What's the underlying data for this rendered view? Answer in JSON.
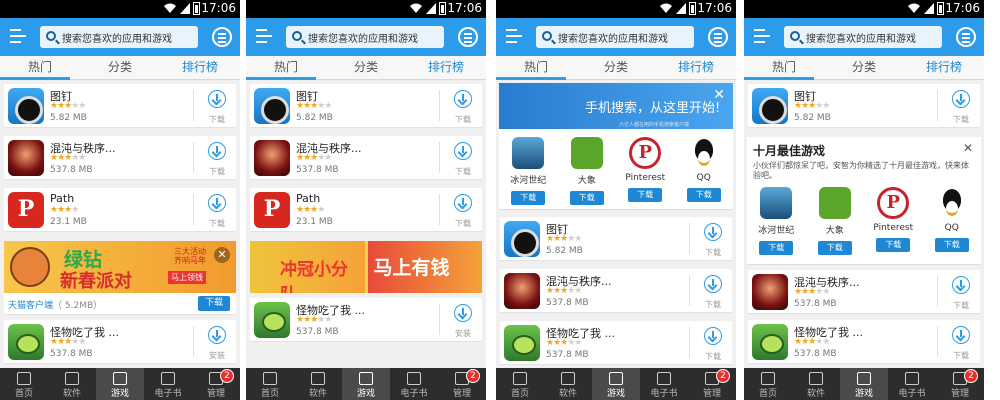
{
  "status": {
    "time": "17:06"
  },
  "topbar": {
    "search_placeholder": "搜索您喜欢的应用和游戏"
  },
  "tabs": [
    "热门",
    "分类",
    "排行榜"
  ],
  "apps": [
    {
      "name": "图钉",
      "size": "5.82 MB",
      "rating": 3
    },
    {
      "name": "混沌与秩序...",
      "size": "537.8 MB",
      "rating": 3
    },
    {
      "name": "Path",
      "size": "23.1 MB",
      "rating": 3
    },
    {
      "name": "怪物吃了我 ...",
      "size": "537.8 MB",
      "rating": 3
    }
  ],
  "download_label": "下载",
  "install_label": "安装",
  "banner1": {
    "title_line1": "绿钻",
    "title_line2": "新春派对",
    "promo_small": "三大活动\n齐响马年",
    "promo_btn": "马上领钱",
    "source_app": "天猫客户端",
    "source_size": "（ 5.2MB）",
    "download_btn": "下载"
  },
  "banner2": {
    "left_text": "冲冠小分队",
    "right_text": "马上有钱"
  },
  "promo": {
    "title": "手机搜索，从这里开始!",
    "subtitle": "六亿人都在用的手机搜索客户端",
    "apps": [
      {
        "label": "冰河世纪",
        "btn": "下载"
      },
      {
        "label": "大象",
        "btn": "下载"
      },
      {
        "label": "Pinterest",
        "btn": "下载"
      },
      {
        "label": "QQ",
        "btn": "下载"
      }
    ]
  },
  "popup": {
    "title": "十月最佳游戏",
    "desc": "小伙伴们都惊呆了吧，安智为你精选了十月最佳游戏，快来体验吧。",
    "apps": [
      {
        "label": "冰河世纪",
        "btn": "下载"
      },
      {
        "label": "大象",
        "btn": "下载"
      },
      {
        "label": "Pinterest",
        "btn": "下载"
      },
      {
        "label": "QQ",
        "btn": "下载"
      }
    ]
  },
  "bottom_nav": [
    "首页",
    "软件",
    "游戏",
    "电子书",
    "管理"
  ],
  "badge_count": "2",
  "colors": {
    "accent": "#2b9bea",
    "nav_bg": "#2d2d2d",
    "star": "#f5a623",
    "badge": "#e8312a"
  }
}
